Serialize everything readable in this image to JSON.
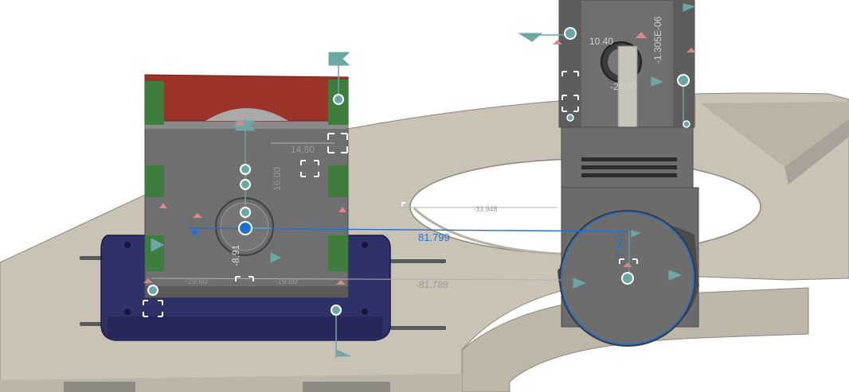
{
  "app": {
    "view": "3D model viewport"
  },
  "colors": {
    "plate": "#c9c3b6",
    "plate_edge": "#8d877c",
    "body": "#6f6f6f",
    "body_dark": "#4b4b4b",
    "green_pad": "#3e7d3d",
    "red_top": "#9c3328",
    "base_block": "#2f3169",
    "selection": "#1f6fd8",
    "triad_teal": "#6aa7a5",
    "triad_red": "#e08585"
  },
  "dimensions": {
    "d_81_799": "81.799",
    "d_neg_81_789": "-81.789",
    "d_14_60": "14.60",
    "d_16_00": "16.00",
    "d_neg_19_60_left": "-19.60",
    "d_neg_19_60_right": "-19.60",
    "d_neg_33_948": "-33.948",
    "d_neg_8_91": "-8.91",
    "d_1_541": "1.541",
    "d_neg_24_90": "-24.90",
    "d_10_40": "10.40",
    "d_neg_1_305e_06": "-1.305E-06"
  },
  "icons": {
    "triad": "move-triad-icon",
    "grip": "grip-handle-icon",
    "target": "origin-target-icon"
  }
}
